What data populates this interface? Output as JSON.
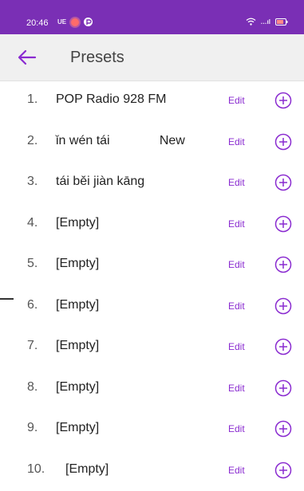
{
  "status_bar": {
    "time": "20:46",
    "left_text": "UE",
    "right_text": "…ıl",
    "icons": [
      "notification-dot-icon",
      "p-circle-icon",
      "wifi-icon",
      "signal-icon",
      "battery-icon"
    ]
  },
  "app_bar": {
    "title": "Presets",
    "back_icon": "arrow-left-icon"
  },
  "presets": [
    {
      "number": "1.",
      "name": "POP Radio 928 FM",
      "edit": "Edit",
      "add_icon": "plus-circle-icon"
    },
    {
      "number": "2.",
      "name": "ǐn wén tái              New",
      "edit": "Edit",
      "add_icon": "plus-circle-icon"
    },
    {
      "number": "3.",
      "name": "tái běi jiàn kāng",
      "edit": "Edit",
      "add_icon": "plus-circle-icon"
    },
    {
      "number": "4.",
      "name": "[Empty]",
      "edit": "Edit",
      "add_icon": "plus-circle-icon"
    },
    {
      "number": "5.",
      "name": "[Empty]",
      "edit": "Edit",
      "add_icon": "plus-circle-icon"
    },
    {
      "number": "6.",
      "name": "[Empty]",
      "edit": "Edit",
      "add_icon": "plus-circle-icon"
    },
    {
      "number": "7.",
      "name": "[Empty]",
      "edit": "Edit",
      "add_icon": "plus-circle-icon"
    },
    {
      "number": "8.",
      "name": "[Empty]",
      "edit": "Edit",
      "add_icon": "plus-circle-icon"
    },
    {
      "number": "9.",
      "name": "[Empty]",
      "edit": "Edit",
      "add_icon": "plus-circle-icon"
    },
    {
      "number": "10.",
      "name": "[Empty]",
      "edit": "Edit",
      "add_icon": "plus-circle-icon"
    }
  ],
  "colors": {
    "status_bar_bg": "#7a2fb5",
    "accent": "#8a2bd0",
    "app_bar_bg": "#f0f0f0",
    "text": "#222222"
  }
}
